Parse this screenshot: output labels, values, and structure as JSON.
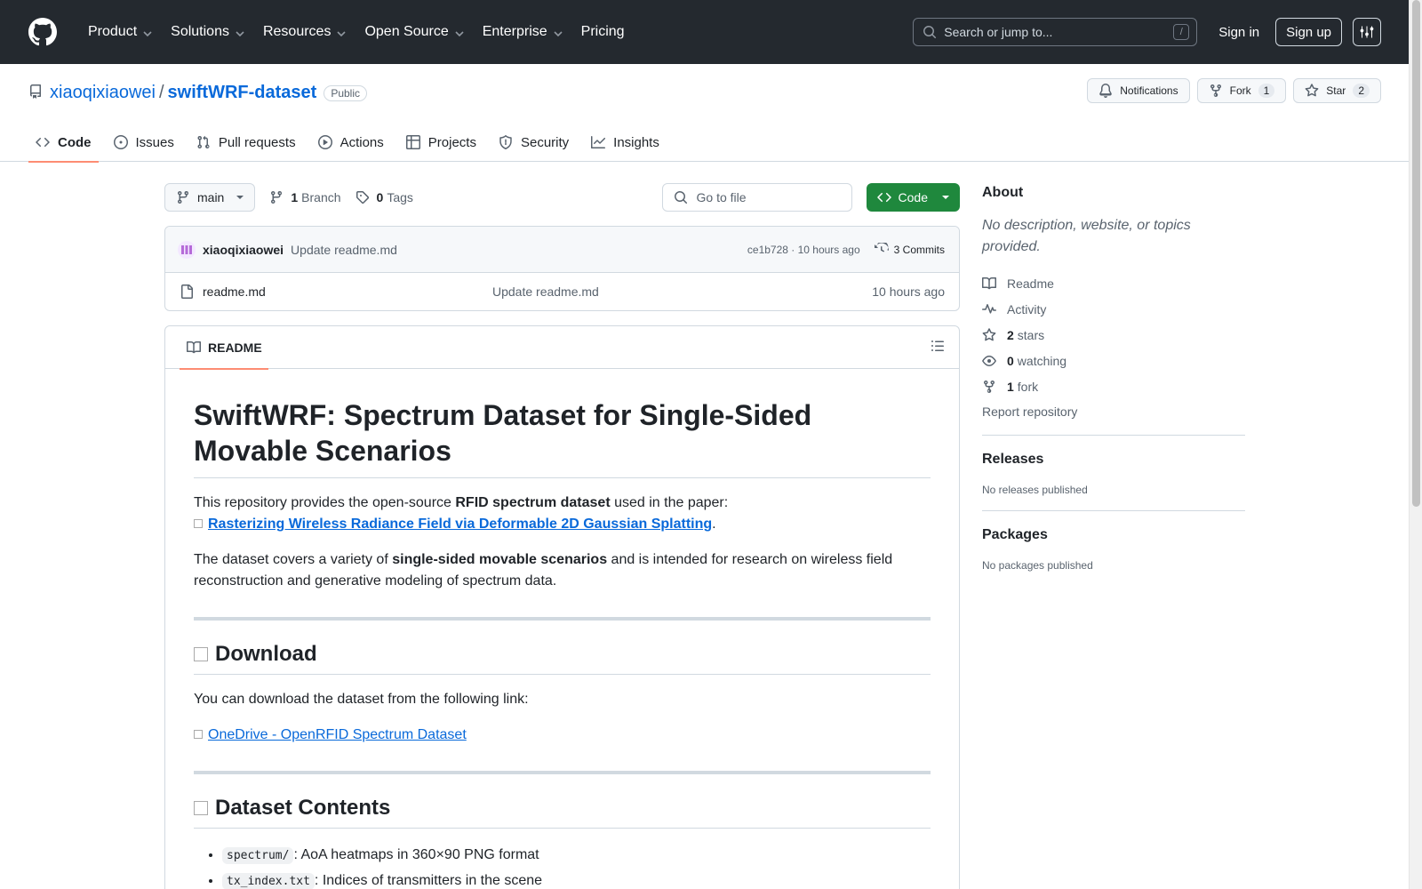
{
  "nav": {
    "items": [
      "Product",
      "Solutions",
      "Resources",
      "Open Source",
      "Enterprise",
      "Pricing"
    ],
    "search_placeholder": "Search or jump to...",
    "search_kbd": "/",
    "signin": "Sign in",
    "signup": "Sign up"
  },
  "repo": {
    "owner": "xiaoqixiaowei",
    "separator": "/",
    "name": "swiftWRF-dataset",
    "visibility": "Public",
    "notifications": "Notifications",
    "fork_label": "Fork",
    "fork_count": "1",
    "star_label": "Star",
    "star_count": "2"
  },
  "tabs": [
    "Code",
    "Issues",
    "Pull requests",
    "Actions",
    "Projects",
    "Security",
    "Insights"
  ],
  "toolbar": {
    "branch": "main",
    "branch_count": "1",
    "branch_label": "Branch",
    "tag_count": "0",
    "tag_label": "Tags",
    "goto_placeholder": "Go to file",
    "code_button": "Code"
  },
  "commit": {
    "author": "xiaoqixiaowei",
    "message": "Update readme.md",
    "hash_time": "ce1b728 · 10 hours ago",
    "commits": "3 Commits"
  },
  "files": [
    {
      "name": "readme.md",
      "message": "Update readme.md",
      "time": "10 hours ago"
    }
  ],
  "readme": {
    "tab": "README",
    "title": "SwiftWRF: Spectrum Dataset for Single-Sided Movable Scenarios",
    "p1_a": "This repository provides the open-source ",
    "p1_b": "RFID spectrum dataset",
    "p1_c": " used in the paper:",
    "paper_link": "Rasterizing Wireless Radiance Field via Deformable 2D Gaussian Splatting",
    "p1_end": ".",
    "p2_a": "The dataset covers a variety of ",
    "p2_b": "single-sided movable scenarios",
    "p2_c": " and is intended for research on wireless field reconstruction and generative modeling of spectrum data.",
    "h_download": "Download",
    "download_text": "You can download the dataset from the following link:",
    "download_link": "OneDrive - OpenRFID Spectrum Dataset",
    "h_contents": "Dataset Contents",
    "items": [
      {
        "code": "spectrum/",
        "text": ": AoA heatmaps in 360×90 PNG format"
      },
      {
        "code": "tx_index.txt",
        "text": ": Indices of transmitters in the scene"
      }
    ]
  },
  "sidebar": {
    "about": "About",
    "desc": "No description, website, or topics provided.",
    "readme": "Readme",
    "activity": "Activity",
    "stars_n": "2",
    "stars": "stars",
    "watching_n": "0",
    "watching": "watching",
    "fork_n": "1",
    "fork": "fork",
    "report": "Report repository",
    "releases": "Releases",
    "releases_note": "No releases published",
    "packages": "Packages",
    "packages_note": "No packages published"
  }
}
